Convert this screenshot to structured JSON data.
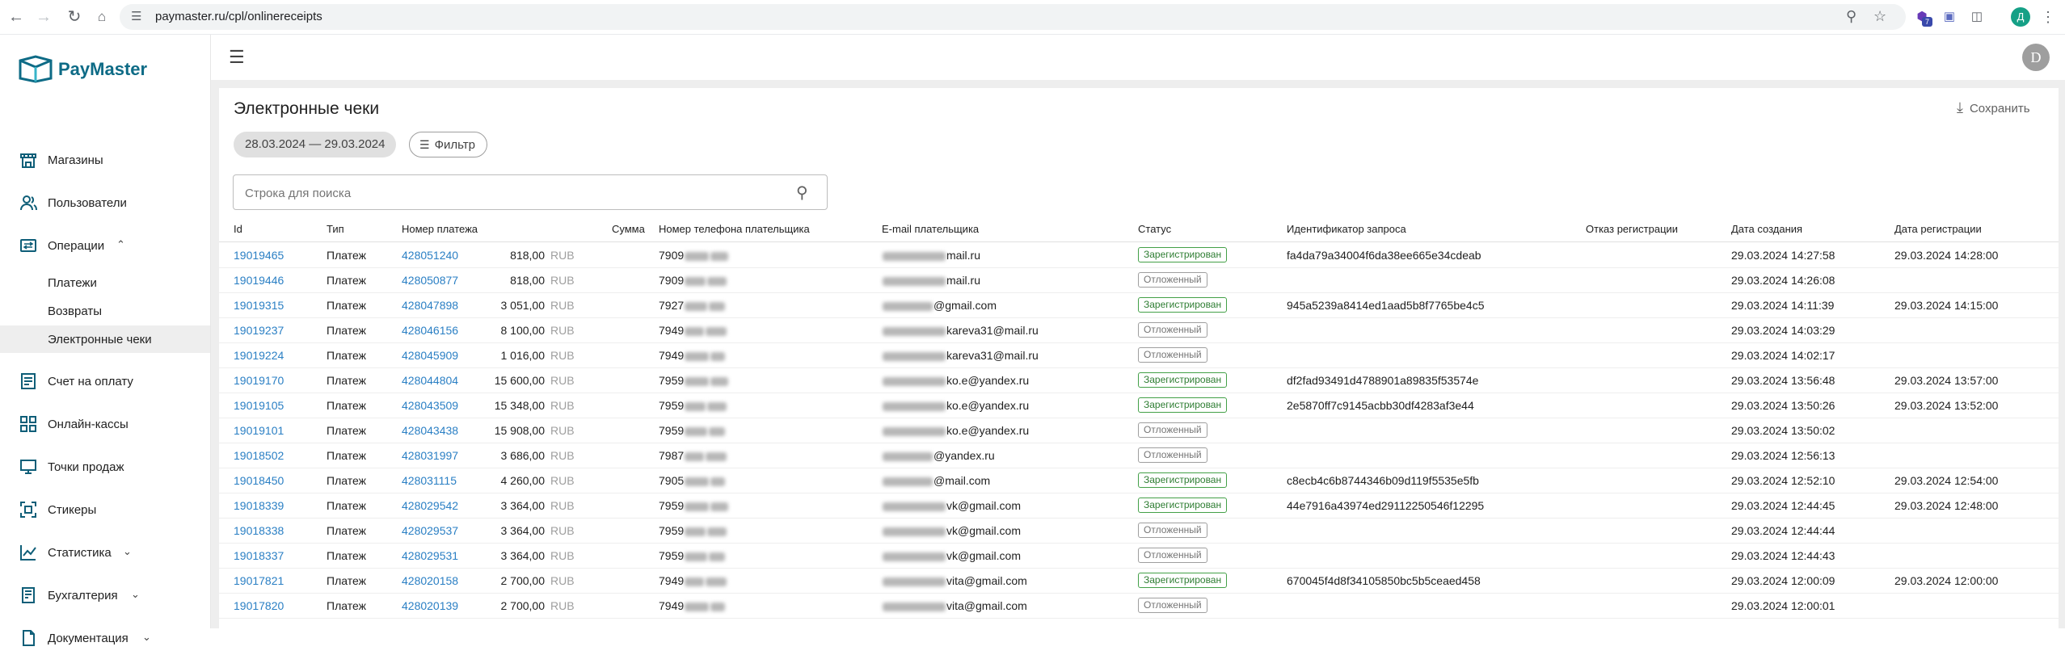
{
  "browser": {
    "url": "paymaster.ru/cpl/onlinereceipts",
    "profile_letter": "Д",
    "extension_badge": "7"
  },
  "sidebar": {
    "logo_text": "PayMaster",
    "items": [
      {
        "label": "Магазины",
        "icon": "shop-icon"
      },
      {
        "label": "Пользователи",
        "icon": "users-icon"
      },
      {
        "label": "Операции",
        "icon": "operations-icon",
        "expanded": true,
        "children": [
          {
            "label": "Платежи"
          },
          {
            "label": "Возвраты"
          },
          {
            "label": "Электронные чеки",
            "active": true
          }
        ]
      },
      {
        "label": "Счет на оплату",
        "icon": "invoice-icon"
      },
      {
        "label": "Онлайн-кассы",
        "icon": "cashbox-icon"
      },
      {
        "label": "Точки продаж",
        "icon": "pos-icon"
      },
      {
        "label": "Стикеры",
        "icon": "qr-icon"
      },
      {
        "label": "Статистика",
        "icon": "chart-icon",
        "expandable": true
      },
      {
        "label": "Бухгалтерия",
        "icon": "accounting-icon",
        "expandable": true
      },
      {
        "label": "Документация",
        "icon": "docs-icon",
        "expandable": true
      }
    ]
  },
  "header": {
    "avatar_letter": "D"
  },
  "page": {
    "title": "Электронные чеки",
    "save_label": "Сохранить",
    "date_range": "28.03.2024 — 29.03.2024",
    "filter_label": "Фильтр",
    "search_placeholder": "Строка для поиска"
  },
  "table": {
    "columns": [
      "Id",
      "Тип",
      "Номер платежа",
      "Сумма",
      "Номер телефона плательщика",
      "E-mail плательщика",
      "Статус",
      "Идентификатор запроса",
      "Отказ регистрации",
      "Дата создания",
      "Дата регистрации"
    ],
    "currency": "RUB",
    "rows": [
      {
        "id": "19019465",
        "type": "Платеж",
        "payment": "428051240",
        "amount": "818,00",
        "phone": "7909",
        "email": "mail.ru",
        "status": "Зарегистрирован",
        "status_kind": "ok",
        "request_id": "fa4da79a34004f6da38ee665e34cdeab",
        "rejection": "",
        "created": "29.03.2024 14:27:58",
        "registered": "29.03.2024 14:28:00"
      },
      {
        "id": "19019446",
        "type": "Платеж",
        "payment": "428050877",
        "amount": "818,00",
        "phone": "7909",
        "email": "mail.ru",
        "status": "Отложенный",
        "status_kind": "def",
        "request_id": "",
        "rejection": "",
        "created": "29.03.2024 14:26:08",
        "registered": ""
      },
      {
        "id": "19019315",
        "type": "Платеж",
        "payment": "428047898",
        "amount": "3 051,00",
        "phone": "7927",
        "email": "@gmail.com",
        "status": "Зарегистрирован",
        "status_kind": "ok",
        "request_id": "945a5239a8414ed1aad5b8f7765be4c5",
        "rejection": "",
        "created": "29.03.2024 14:11:39",
        "registered": "29.03.2024 14:15:00"
      },
      {
        "id": "19019237",
        "type": "Платеж",
        "payment": "428046156",
        "amount": "8 100,00",
        "phone": "7949",
        "email": "kareva31@mail.ru",
        "status": "Отложенный",
        "status_kind": "def",
        "request_id": "",
        "rejection": "",
        "created": "29.03.2024 14:03:29",
        "registered": ""
      },
      {
        "id": "19019224",
        "type": "Платеж",
        "payment": "428045909",
        "amount": "1 016,00",
        "phone": "7949",
        "email": "kareva31@mail.ru",
        "status": "Отложенный",
        "status_kind": "def",
        "request_id": "",
        "rejection": "",
        "created": "29.03.2024 14:02:17",
        "registered": ""
      },
      {
        "id": "19019170",
        "type": "Платеж",
        "payment": "428044804",
        "amount": "15 600,00",
        "phone": "7959",
        "email": "ko.e@yandex.ru",
        "status": "Зарегистрирован",
        "status_kind": "ok",
        "request_id": "df2fad93491d4788901a89835f53574e",
        "rejection": "",
        "created": "29.03.2024 13:56:48",
        "registered": "29.03.2024 13:57:00"
      },
      {
        "id": "19019105",
        "type": "Платеж",
        "payment": "428043509",
        "amount": "15 348,00",
        "phone": "7959",
        "email": "ko.e@yandex.ru",
        "status": "Зарегистрирован",
        "status_kind": "ok",
        "request_id": "2e5870ff7c9145acbb30df4283af3e44",
        "rejection": "",
        "created": "29.03.2024 13:50:26",
        "registered": "29.03.2024 13:52:00"
      },
      {
        "id": "19019101",
        "type": "Платеж",
        "payment": "428043438",
        "amount": "15 908,00",
        "phone": "7959",
        "email": "ko.e@yandex.ru",
        "status": "Отложенный",
        "status_kind": "def",
        "request_id": "",
        "rejection": "",
        "created": "29.03.2024 13:50:02",
        "registered": ""
      },
      {
        "id": "19018502",
        "type": "Платеж",
        "payment": "428031997",
        "amount": "3 686,00",
        "phone": "7987",
        "email": "@yandex.ru",
        "status": "Отложенный",
        "status_kind": "def",
        "request_id": "",
        "rejection": "",
        "created": "29.03.2024 12:56:13",
        "registered": ""
      },
      {
        "id": "19018450",
        "type": "Платеж",
        "payment": "428031115",
        "amount": "4 260,00",
        "phone": "7905",
        "email": "@mail.com",
        "status": "Зарегистрирован",
        "status_kind": "ok",
        "request_id": "c8ecb4c6b8744346b09d119f5535e5fb",
        "rejection": "",
        "created": "29.03.2024 12:52:10",
        "registered": "29.03.2024 12:54:00"
      },
      {
        "id": "19018339",
        "type": "Платеж",
        "payment": "428029542",
        "amount": "3 364,00",
        "phone": "7959",
        "email": "vk@gmail.com",
        "status": "Зарегистрирован",
        "status_kind": "ok",
        "request_id": "44e7916a43974ed29112250546f12295",
        "rejection": "",
        "created": "29.03.2024 12:44:45",
        "registered": "29.03.2024 12:48:00"
      },
      {
        "id": "19018338",
        "type": "Платеж",
        "payment": "428029537",
        "amount": "3 364,00",
        "phone": "7959",
        "email": "vk@gmail.com",
        "status": "Отложенный",
        "status_kind": "def",
        "request_id": "",
        "rejection": "",
        "created": "29.03.2024 12:44:44",
        "registered": ""
      },
      {
        "id": "19018337",
        "type": "Платеж",
        "payment": "428029531",
        "amount": "3 364,00",
        "phone": "7959",
        "email": "vk@gmail.com",
        "status": "Отложенный",
        "status_kind": "def",
        "request_id": "",
        "rejection": "",
        "created": "29.03.2024 12:44:43",
        "registered": ""
      },
      {
        "id": "19017821",
        "type": "Платеж",
        "payment": "428020158",
        "amount": "2 700,00",
        "phone": "7949",
        "email": "vita@gmail.com",
        "status": "Зарегистрирован",
        "status_kind": "ok",
        "request_id": "670045f4d8f34105850bc5b5ceaed458",
        "rejection": "",
        "created": "29.03.2024 12:00:09",
        "registered": "29.03.2024 12:00:00"
      },
      {
        "id": "19017820",
        "type": "Платеж",
        "payment": "428020139",
        "amount": "2 700,00",
        "phone": "7949",
        "email": "vita@gmail.com",
        "status": "Отложенный",
        "status_kind": "def",
        "request_id": "",
        "rejection": "",
        "created": "29.03.2024 12:00:01",
        "registered": ""
      }
    ]
  },
  "colors": {
    "brand": "#0e6b86",
    "link": "#2a7fc4",
    "status_ok": "#2e7d32",
    "status_deferred": "#757575"
  }
}
